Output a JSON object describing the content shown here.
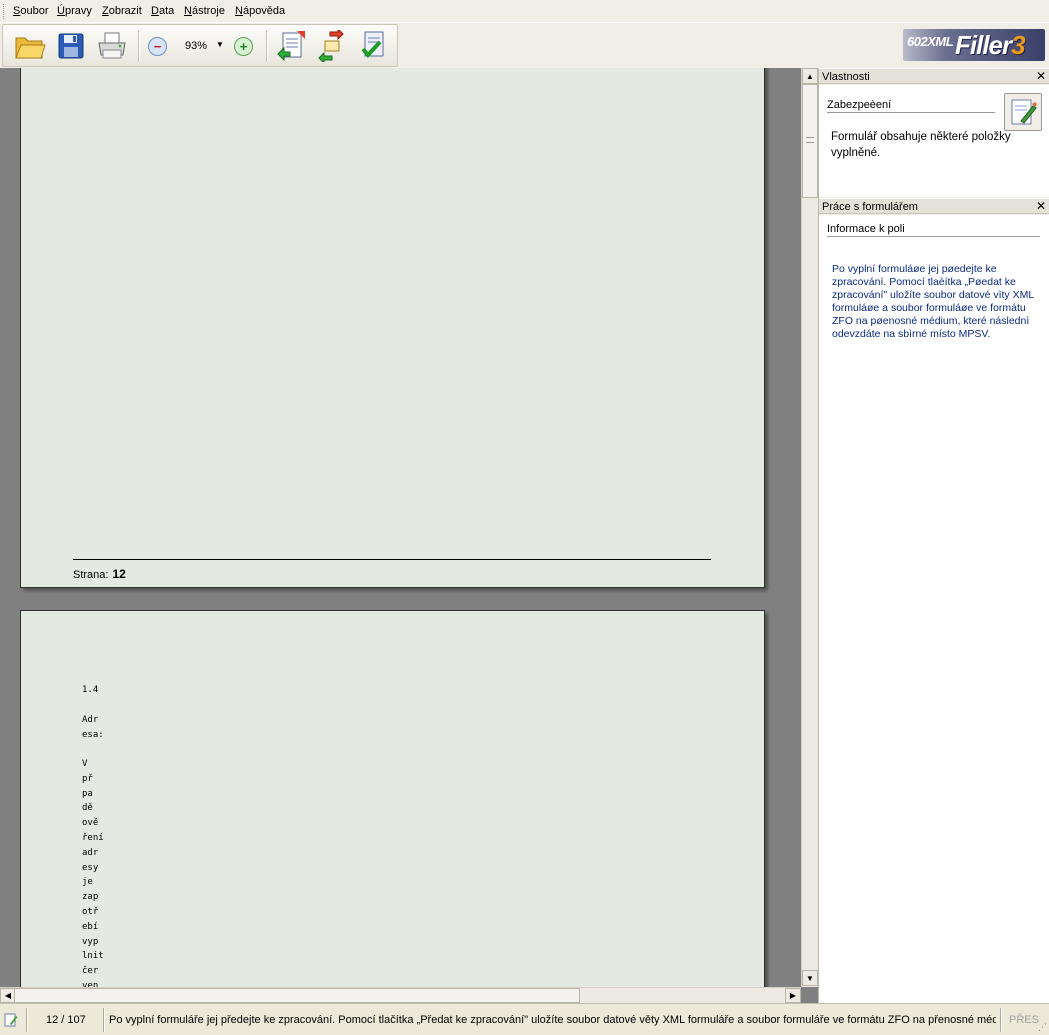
{
  "menu": {
    "items": [
      "Soubor",
      "Úpravy",
      "Zobrazit",
      "Data",
      "Nástroje",
      "Nápověda"
    ]
  },
  "toolbar": {
    "open_icon": "folder-open-icon",
    "save_icon": "floppy-disk-icon",
    "print_icon": "printer-icon",
    "zoom_out_icon": "zoom-out-icon",
    "zoom_in_icon": "zoom-in-icon",
    "zoom_value": "93%",
    "form_import_icon": "form-import-icon",
    "form_export_icon": "form-export-icon",
    "form_validate_icon": "form-validate-icon"
  },
  "logo": {
    "prefix": "602XML",
    "name": "Filler",
    "version": "3"
  },
  "document": {
    "page1": {
      "footer_label": "Strana:",
      "footer_number": "12"
    },
    "page2": {
      "section_number": "1.4",
      "address_label": "Adr\nesa:",
      "body_text": "V\npř\npa\ndě\nově\nření\nadr\nesy\nje\nzap\notř\nebí\nvyp\nlnit\nčer\nven"
    }
  },
  "panels": {
    "properties": {
      "title": "Vlastnosti",
      "section": "Zabezpeèení",
      "icon": "signature-edit-icon",
      "text": "Formulář obsahuje některé položky vyplněné."
    },
    "form_work": {
      "title": "Práce s formulářem",
      "section": "Informace k poli",
      "text": "Po vyplní formuláøe jej pøedejte ke zpracování. Pomocí tlaèítka „Pøedat ke zpracování\" uložíte soubor datové vìty XML formuláøe a soubor formuláøe ve formátu ZFO na pøenosné médium, které následnì odevzdáte na sbìrné místo MPSV."
    }
  },
  "statusbar": {
    "page": "12 / 107",
    "message": "Po vyplní formuláře jej předejte ke zpracování. Pomocí tlačítka „Předat ke zpracování\" uložíte soubor datové věty XML formuláře a soubor formuláře ve formátu ZFO na přenosné médium",
    "mode": "PŘES"
  },
  "colors": {
    "page_bg": "#e4e9e1",
    "workspace_bg": "#808080",
    "info_text": "#0b2a80",
    "chrome_bg": "#f0eee6"
  }
}
